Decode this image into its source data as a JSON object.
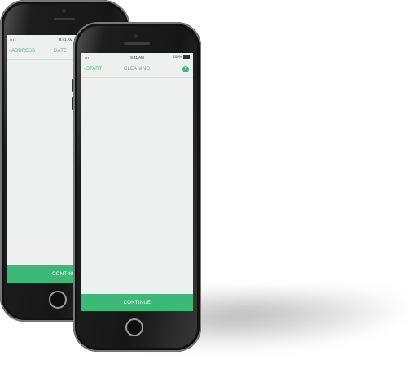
{
  "back_phone": {
    "status_time": "9:41 AM",
    "back_label": "ADDRESS",
    "title": "DATE",
    "continue_label": "CONTINUE"
  },
  "front_phone": {
    "status_time": "9:41 AM",
    "battery": "100%",
    "back_label": "START",
    "title": "CLEANING",
    "help_icon": "question-icon",
    "continue_label": "CONTINUE"
  },
  "colors": {
    "accent": "#3cb878",
    "screen_bg": "#eef0ef",
    "title_gray": "#8a8f8d"
  }
}
